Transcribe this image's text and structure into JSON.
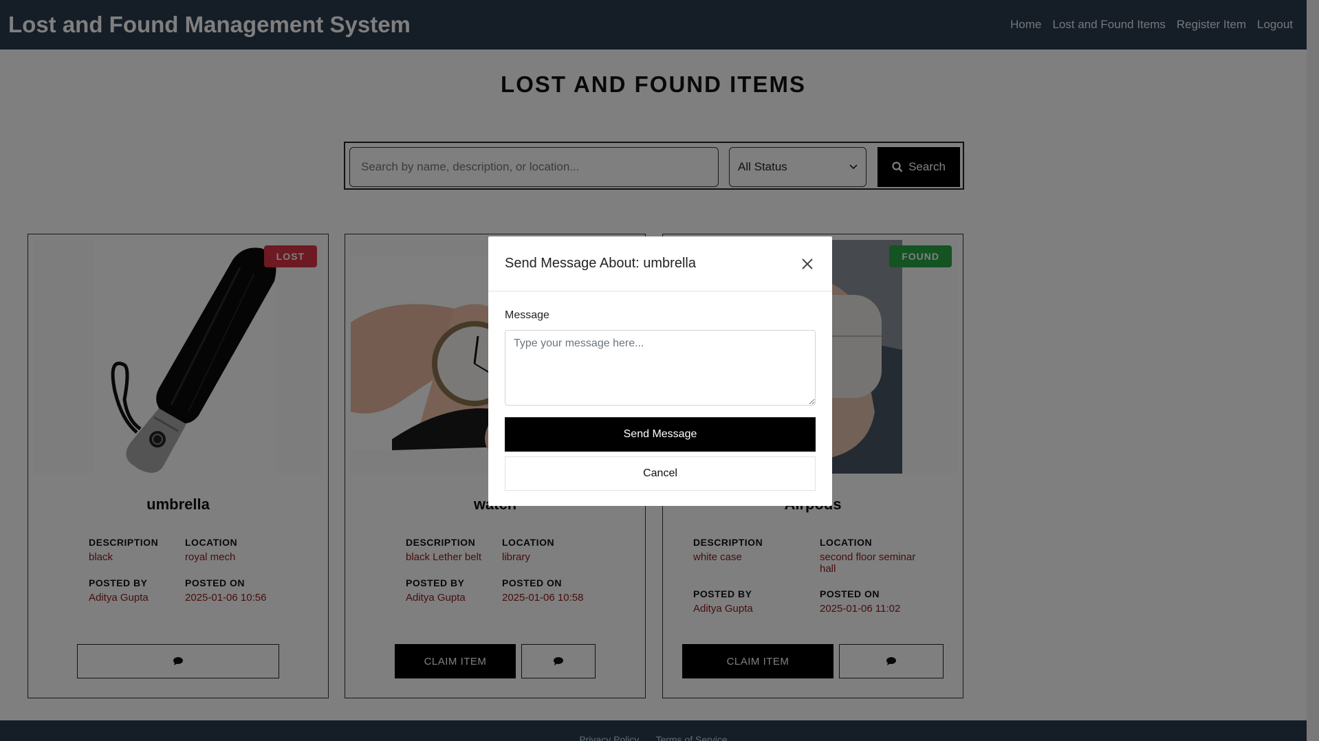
{
  "navbar": {
    "title": "Lost and Found Management System",
    "links": [
      "Home",
      "Lost and Found Items",
      "Register Item",
      "Logout"
    ]
  },
  "page": {
    "title": "LOST AND FOUND ITEMS"
  },
  "search": {
    "placeholder": "Search by name, description, or location...",
    "status_value": "All Status",
    "button_label": "Search"
  },
  "labels": {
    "description": "DESCRIPTION",
    "location": "LOCATION",
    "posted_by": "POSTED BY",
    "posted_on": "POSTED ON",
    "claim": "CLAIM ITEM"
  },
  "items": [
    {
      "name": "umbrella",
      "status": "LOST",
      "description": "black",
      "location": "royal mech",
      "posted_by": "Aditya Gupta",
      "posted_on": "2025-01-06 10:56",
      "image": "umbrella-photo"
    },
    {
      "name": "watch",
      "status": "",
      "description": "black Lether belt",
      "location": "library",
      "posted_by": "Aditya Gupta",
      "posted_on": "2025-01-06 10:58",
      "image": "watch-photo"
    },
    {
      "name": "Airpods",
      "status": "FOUND",
      "description": "white case",
      "location": "second floor seminar hall",
      "posted_by": "Aditya Gupta",
      "posted_on": "2025-01-06 11:02",
      "image": "airpods-photo"
    }
  ],
  "modal": {
    "title": "Send Message About: umbrella",
    "message_label": "Message",
    "message_placeholder": "Type your message here...",
    "send_label": "Send Message",
    "cancel_label": "Cancel"
  },
  "footer": {
    "links": [
      "Privacy Policy",
      "Terms of Service"
    ]
  },
  "colors": {
    "navbar": "#2b3a4e",
    "lost": "#dc3545",
    "found": "#28a745",
    "value_text": "#8b1a1a"
  }
}
